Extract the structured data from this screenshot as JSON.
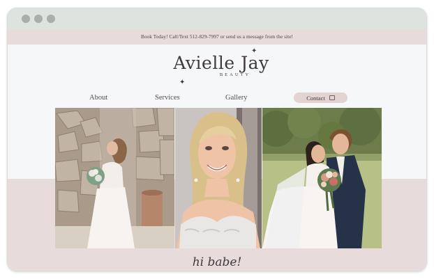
{
  "window": {
    "controls": [
      "close",
      "minimize",
      "maximize"
    ]
  },
  "announcement": {
    "text": "Book Today! Call/Text 512-829-7997 or send us a message from the site!"
  },
  "logo": {
    "name": "Avielle Jay",
    "subtitle": "BEAUTY"
  },
  "nav": {
    "items": [
      "About",
      "Services",
      "Gallery"
    ],
    "contact_label": "Contact",
    "contact_icon": "calendar-icon"
  },
  "gallery": {
    "photos": [
      {
        "icon": "bride-stone-wall-photo"
      },
      {
        "icon": "bride-portrait-photo"
      },
      {
        "icon": "couple-portrait-photo"
      }
    ]
  },
  "greeting": {
    "text": "hi babe!"
  },
  "colors": {
    "titlebar": "#dde3df",
    "announcement_bg": "#e7dcda",
    "page_bg": "#f6f7f9",
    "accent_band": "#e7dcdb",
    "contact_button": "#e3d3d2",
    "text": "#3f3a3c"
  }
}
